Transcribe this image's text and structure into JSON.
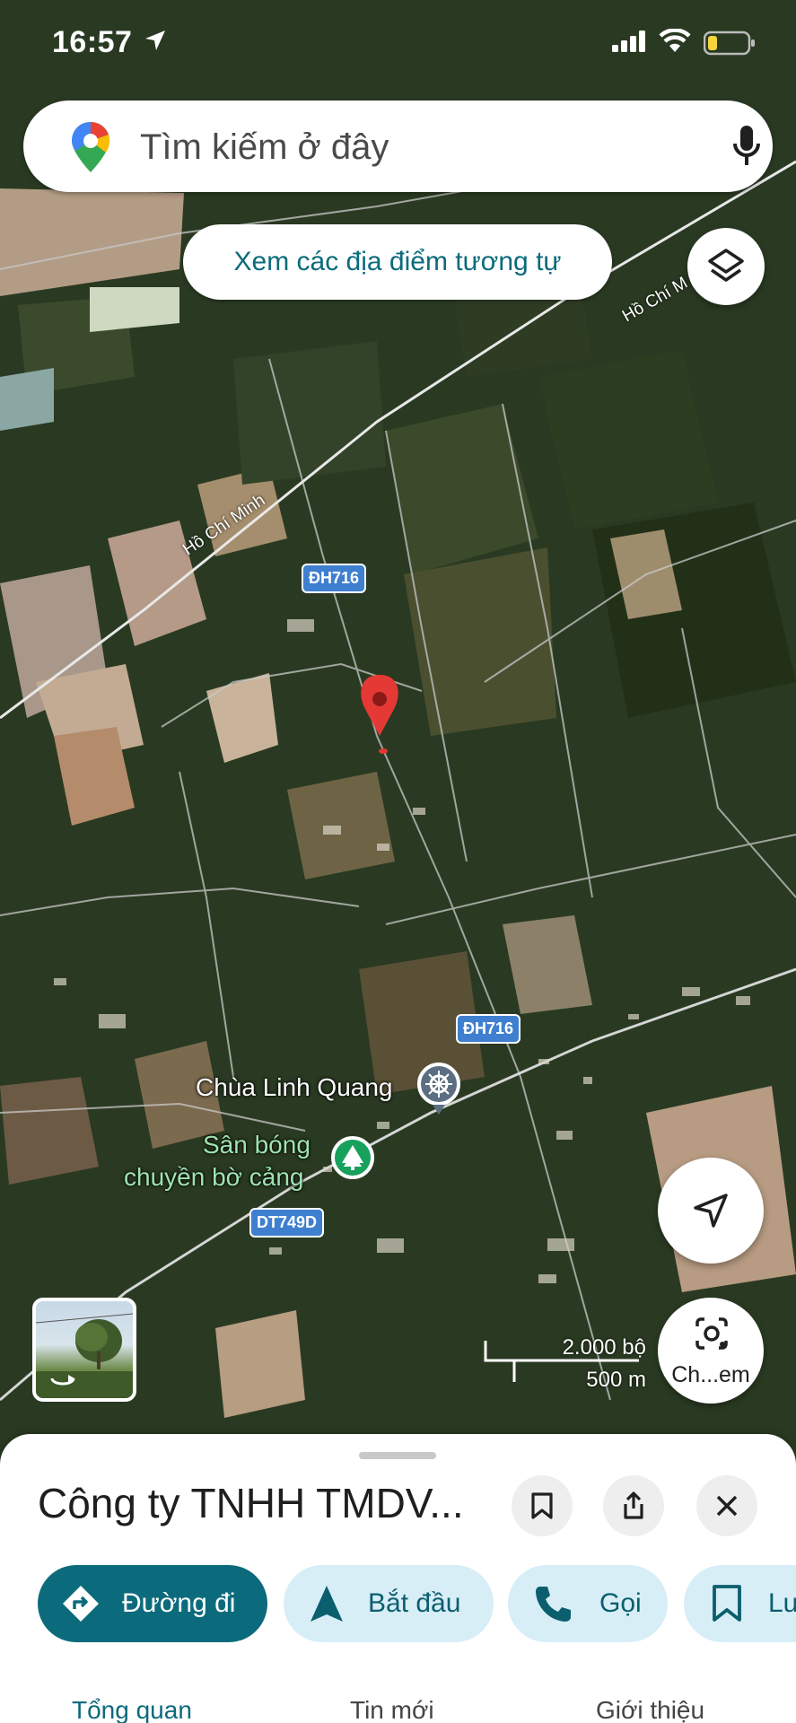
{
  "status_bar": {
    "time": "16:57",
    "icons": [
      "location-arrow-icon",
      "signal-icon",
      "wifi-icon",
      "battery-low-icon"
    ]
  },
  "search": {
    "placeholder": "Tìm kiếm ở đây",
    "icons": [
      "maps-pin-logo",
      "mic-icon"
    ]
  },
  "map": {
    "similar_places_button": "Xem các địa điểm tương tự",
    "roads": {
      "ho_chi_minh_1": "Hồ Chí Minh",
      "ho_chi_minh_2": "Hồ Chí M"
    },
    "shields": {
      "dh716_top": "ĐH716",
      "dh716_bottom": "ĐH716",
      "dt749d": "DT749D"
    },
    "pois": {
      "temple": "Chùa Linh Quang",
      "court_line1": "Sân bóng",
      "court_line2": "chuyền bờ cảng"
    },
    "scale": {
      "feet": "2.000 bộ",
      "meters": "500 m"
    },
    "lens_label": "Ch...em",
    "colors": {
      "pin": "#e53935",
      "shield": "#3f7fd0",
      "accent": "#0b6b7c"
    }
  },
  "place": {
    "title": "Công ty TNHH TMDV..."
  },
  "actions": {
    "directions": "Đường đi",
    "start": "Bắt đầu",
    "call": "Gọi",
    "save": "Lư"
  },
  "tabs": {
    "overview": "Tổng quan",
    "updates": "Tin mới",
    "about": "Giới thiệu"
  }
}
